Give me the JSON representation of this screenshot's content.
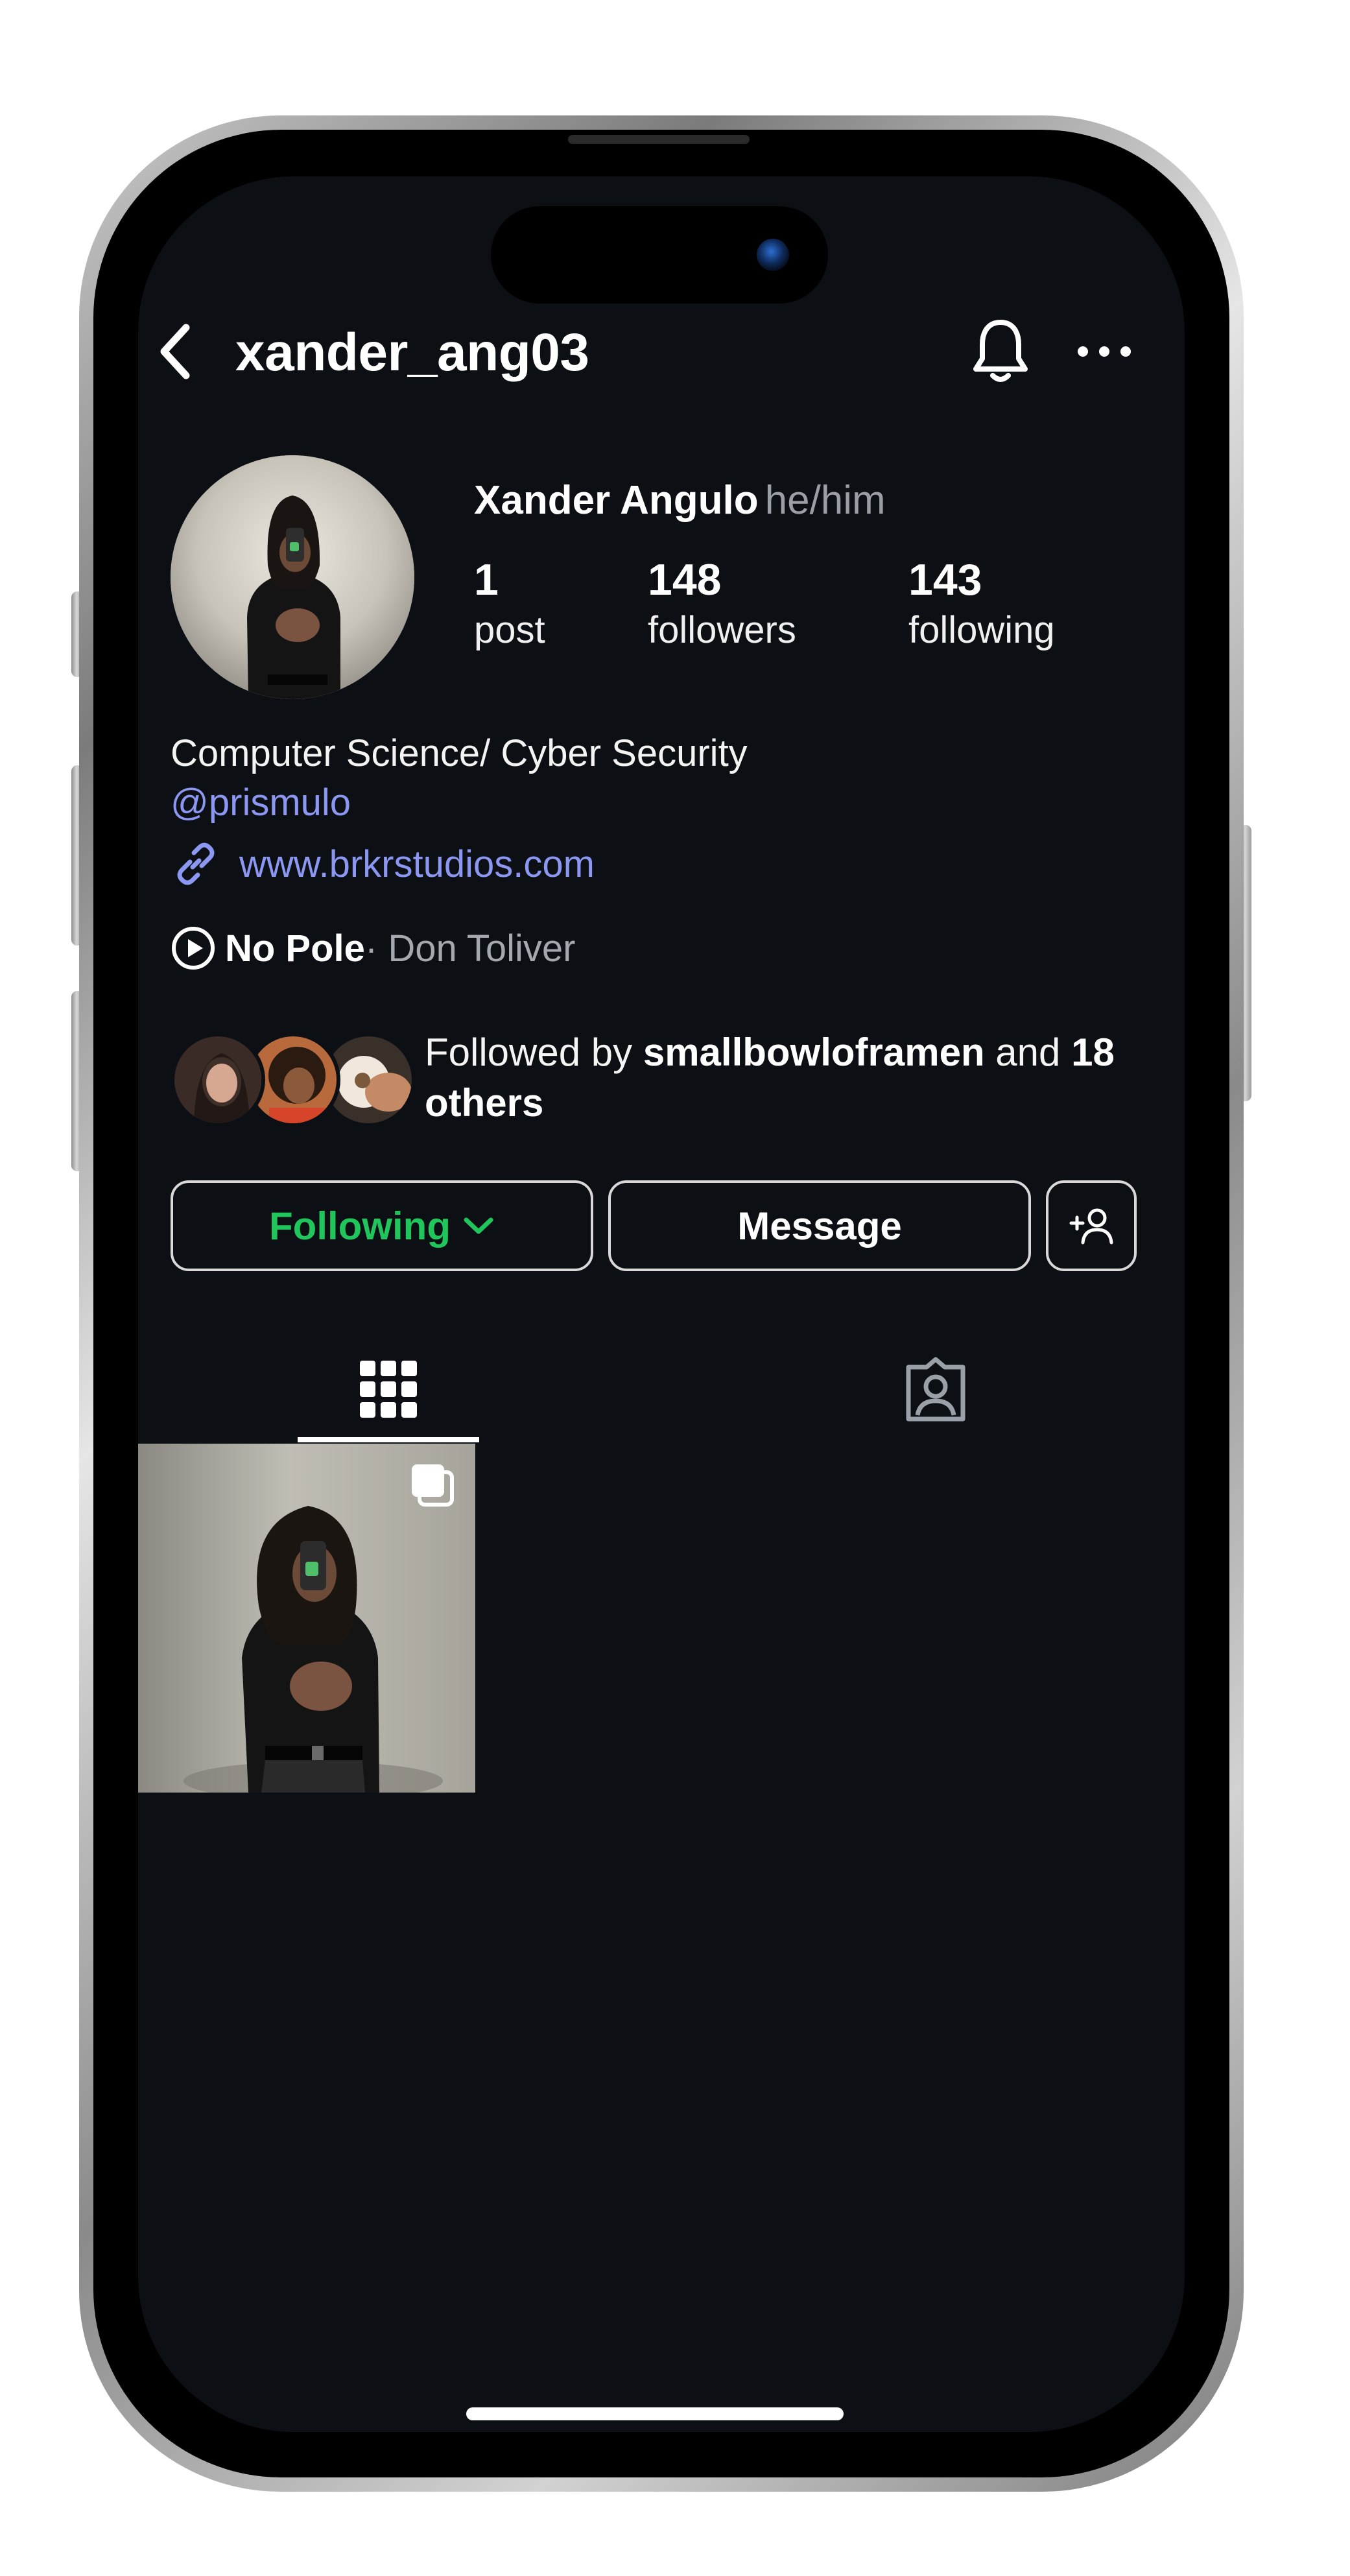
{
  "header": {
    "username": "xander_ang03",
    "back_icon": "chevron-left-icon",
    "bell_icon": "bell-icon",
    "more_icon": "more-horizontal-icon"
  },
  "profile": {
    "display_name": "Xander Angulo",
    "pronouns": "he/him",
    "stats": {
      "posts": {
        "value": "1",
        "label": "post"
      },
      "followers": {
        "value": "148",
        "label": "followers"
      },
      "following": {
        "value": "143",
        "label": "following"
      }
    },
    "bio": "Computer Science/ Cyber Security",
    "mention": "@prismulo",
    "link": "www.brkrstudios.com",
    "music": {
      "song": "No Pole",
      "artist": " · Don Toliver"
    }
  },
  "followed_by": {
    "prefix": "Followed by ",
    "user": "smallbowloframen",
    "middle": " and ",
    "others": "18 others"
  },
  "actions": {
    "following_label": "Following",
    "message_label": "Message"
  },
  "tabs": {
    "posts_icon": "grid-icon",
    "tagged_icon": "tagged-person-icon"
  },
  "colors": {
    "background": "#0c0f14",
    "text": "#ffffff",
    "muted": "#9a9ea6",
    "link": "#8c97f2",
    "following_green": "#20c55b"
  }
}
